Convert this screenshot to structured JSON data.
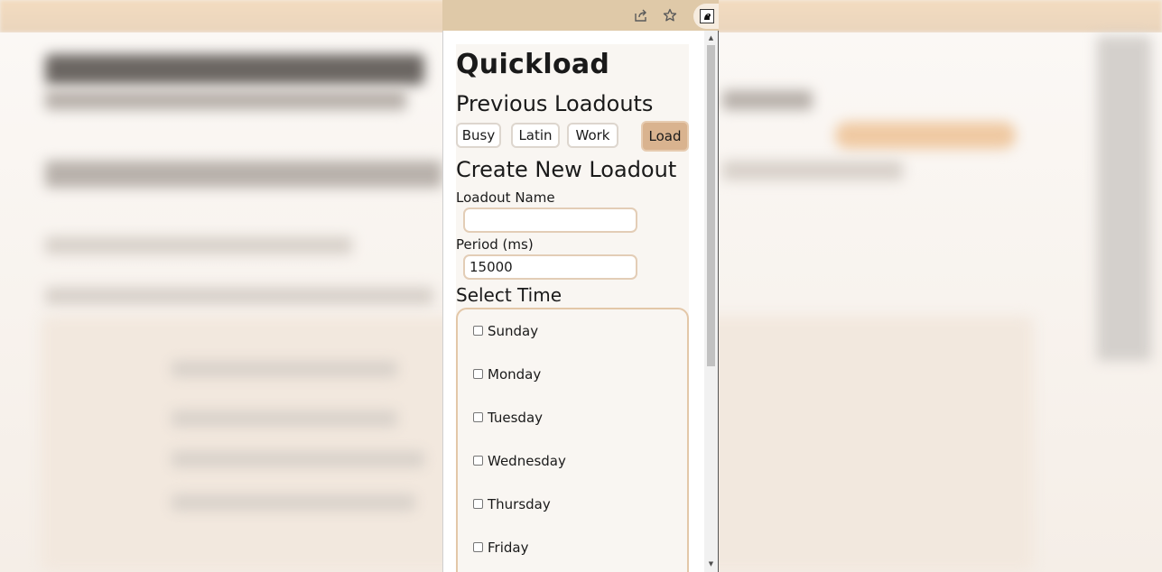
{
  "popup": {
    "title": "Quickload",
    "previous_heading": "Previous Loadouts",
    "loadouts": [
      "Busy",
      "Latin",
      "Work"
    ],
    "load_button": "Load",
    "create_heading": "Create New Loadout",
    "name_label": "Loadout Name",
    "name_value": "",
    "period_label": "Period (ms)",
    "period_value": "15000",
    "time_heading": "Select Time",
    "days": [
      "Sunday",
      "Monday",
      "Tuesday",
      "Wednesday",
      "Thursday",
      "Friday"
    ]
  },
  "toolbar": {
    "icons": [
      "share-icon",
      "star-icon",
      "extension-icon"
    ]
  },
  "colors": {
    "accent": "#d9b38f",
    "border": "#e3cdb6",
    "panel": "#f9f6f2"
  }
}
